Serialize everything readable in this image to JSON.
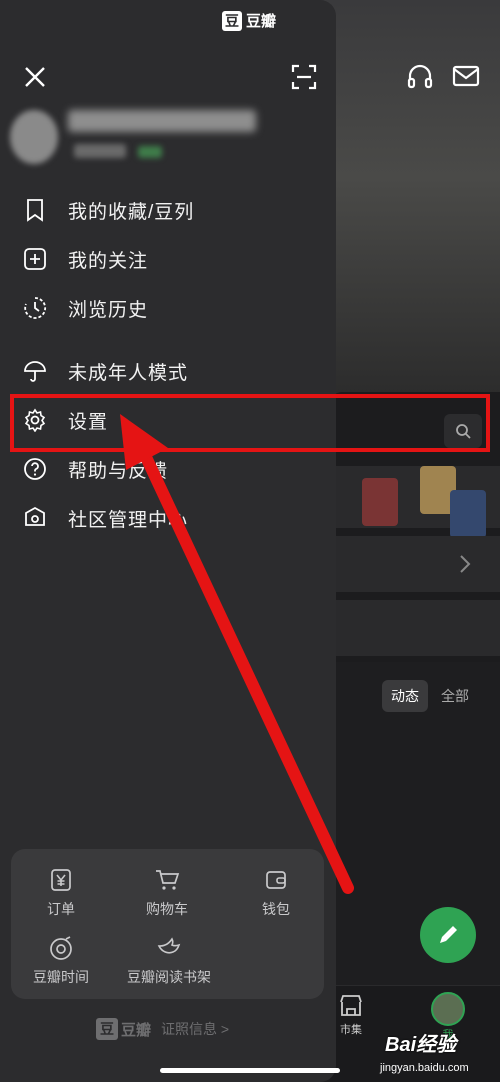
{
  "app": {
    "brand_char": "豆",
    "brand_name": "豆瓣"
  },
  "drawer": {
    "menu": [
      {
        "label": "我的收藏/豆列",
        "icon": "bookmark-icon"
      },
      {
        "label": "我的关注",
        "icon": "plus-square-icon"
      },
      {
        "label": "浏览历史",
        "icon": "history-icon"
      },
      {
        "label": "未成年人模式",
        "icon": "umbrella-icon"
      },
      {
        "label": "设置",
        "icon": "gear-icon"
      },
      {
        "label": "帮助与反馈",
        "icon": "help-circle-icon"
      },
      {
        "label": "社区管理中心",
        "icon": "shield-home-icon"
      }
    ],
    "tools": [
      {
        "label": "订单",
        "icon": "yen-ticket-icon"
      },
      {
        "label": "购物车",
        "icon": "cart-icon"
      },
      {
        "label": "钱包",
        "icon": "wallet-icon"
      },
      {
        "label": "豆瓣时间",
        "icon": "douban-time-icon"
      },
      {
        "label": "豆瓣阅读书架",
        "icon": "reading-bird-icon"
      }
    ],
    "footer": {
      "brand_char": "豆",
      "brand_name": "豆瓣",
      "license_link": "证照信息 >"
    }
  },
  "background": {
    "tabs": [
      {
        "label": "动态",
        "active": true
      },
      {
        "label": "全部",
        "active": false
      }
    ],
    "nav": [
      {
        "label": "市集",
        "icon": "market-icon"
      },
      {
        "label": "我",
        "icon": "avatar"
      }
    ]
  },
  "overlay": {
    "watermark": "Bai经验",
    "watermark_sub": "jingyan.baidu.com",
    "highlight_color": "#e51414"
  },
  "colors": {
    "drawer_bg": "#2c2c2e",
    "accent_green": "#2fa353",
    "annotation_red": "#e51414"
  }
}
